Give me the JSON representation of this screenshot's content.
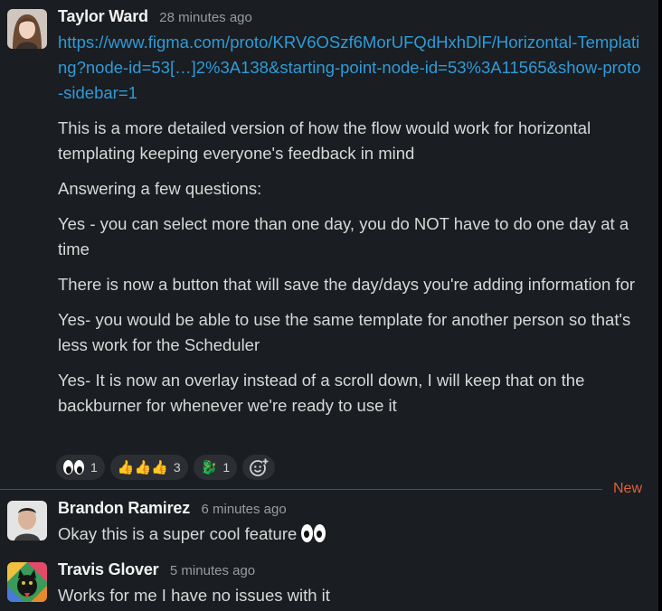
{
  "messages": [
    {
      "author": "Taylor Ward",
      "time": "28 minutes ago",
      "link": "https://www.figma.com/proto/KRV6OSzf6MorUFQdHxhDlF/Horizontal-Templating?node-id=53[…]2%3A138&starting-point-node-id=53%3A11565&show-proto-sidebar=1",
      "paragraphs": [
        "This is a more detailed version of how the flow would work for horizontal templating keeping everyone's feedback in mind",
        "Answering a few questions:",
        "Yes - you can select more than one day, you do NOT have to do one day at a time",
        "There is now a button that will save the day/days you're adding information for",
        "Yes- you would be able to use the same template for another person so that's less work for the Scheduler",
        "Yes- It is now an overlay instead of a scroll down, I will keep that on the backburner for whenever we're ready to use it"
      ],
      "reactions": [
        {
          "emoji": "eyes",
          "count": "1"
        },
        {
          "emoji": "thumbs-up",
          "count": "3"
        },
        {
          "emoji": "dragon",
          "count": "1"
        }
      ]
    },
    {
      "author": "Brandon Ramirez",
      "time": "6 minutes ago",
      "text": "Okay this is a super cool feature",
      "emoji": "eyes"
    },
    {
      "author": "Travis Glover",
      "time": "5 minutes ago",
      "text": "Works for me I have no issues with it"
    }
  ],
  "divider": {
    "label": "New",
    "color": "#e0603d"
  },
  "colors": {
    "link": "#2f9bd8",
    "background": "#1a1d21",
    "reaction_bg": "#2b2e32"
  }
}
